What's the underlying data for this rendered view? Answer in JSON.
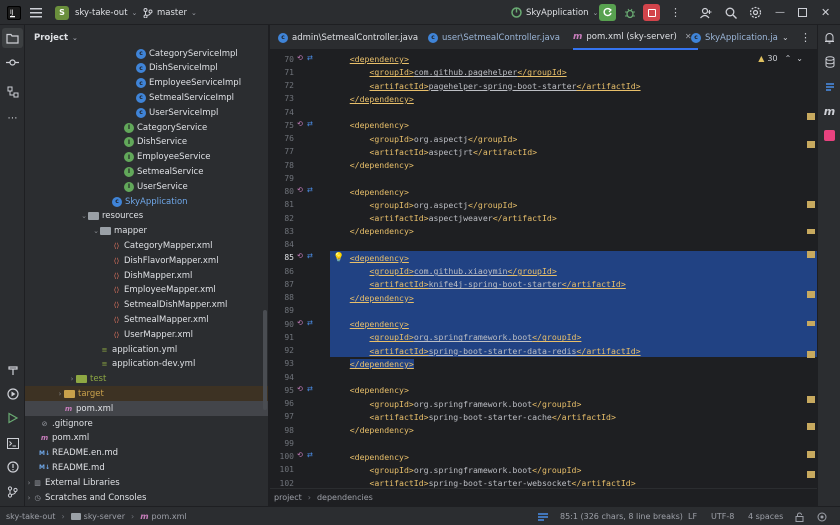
{
  "titlebar": {
    "project_badge": "S",
    "project_name": "sky-take-out",
    "branch": "master",
    "run_config": "SkyApplication"
  },
  "project_panel": {
    "title": "Project",
    "items": [
      {
        "label": "CategoryServiceImpl",
        "icon": "class-blue",
        "indent": 138
      },
      {
        "label": "DishServiceImpl",
        "icon": "class-blue",
        "indent": 138
      },
      {
        "label": "EmployeeServiceImpl",
        "icon": "class-blue",
        "indent": 138
      },
      {
        "label": "SetmealServiceImpl",
        "icon": "class-blue",
        "indent": 138
      },
      {
        "label": "UserServiceImpl",
        "icon": "class-blue",
        "indent": 138
      },
      {
        "label": "CategoryService",
        "icon": "interface-green",
        "indent": 126
      },
      {
        "label": "DishService",
        "icon": "interface-green",
        "indent": 126
      },
      {
        "label": "EmployeeService",
        "icon": "interface-green",
        "indent": 126
      },
      {
        "label": "SetmealService",
        "icon": "interface-green",
        "indent": 126
      },
      {
        "label": "UserService",
        "icon": "interface-green",
        "indent": 126
      },
      {
        "label": "SkyApplication",
        "icon": "class-blue",
        "indent": 114,
        "color": "#6fa7e8"
      },
      {
        "label": "resources",
        "icon": "folder",
        "indent": 90,
        "chevron": "open"
      },
      {
        "label": "mapper",
        "icon": "folder",
        "indent": 102,
        "chevron": "open"
      },
      {
        "label": "CategoryMapper.xml",
        "icon": "xml",
        "indent": 114
      },
      {
        "label": "DishFlavorMapper.xml",
        "icon": "xml",
        "indent": 114
      },
      {
        "label": "DishMapper.xml",
        "icon": "xml",
        "indent": 114
      },
      {
        "label": "EmployeeMapper.xml",
        "icon": "xml",
        "indent": 114
      },
      {
        "label": "SetmealDishMapper.xml",
        "icon": "xml",
        "indent": 114
      },
      {
        "label": "SetmealMapper.xml",
        "icon": "xml",
        "indent": 114
      },
      {
        "label": "UserMapper.xml",
        "icon": "xml",
        "indent": 114
      },
      {
        "label": "application.yml",
        "icon": "yml",
        "indent": 102
      },
      {
        "label": "application-dev.yml",
        "icon": "yml",
        "indent": 102
      },
      {
        "label": "test",
        "icon": "folder",
        "indent": 78,
        "chevron": "closed",
        "color": "#8ea843"
      },
      {
        "label": "target",
        "icon": "folder-orange",
        "indent": 66,
        "chevron": "closed",
        "color": "#c9a14b",
        "bg": "#3d3223"
      },
      {
        "label": "pom.xml",
        "icon": "maven",
        "indent": 66,
        "selected": true
      },
      {
        "label": ".gitignore",
        "icon": "file",
        "indent": 42
      },
      {
        "label": "pom.xml",
        "icon": "maven",
        "indent": 42
      },
      {
        "label": "README.en.md",
        "icon": "md",
        "indent": 42
      },
      {
        "label": "README.md",
        "icon": "md",
        "indent": 42
      },
      {
        "label": "External Libraries",
        "icon": "libs",
        "indent": 18,
        "chevron": "closed"
      },
      {
        "label": "Scratches and Consoles",
        "icon": "scratch",
        "indent": 18,
        "chevron": "closed"
      }
    ]
  },
  "tabs": [
    {
      "label": "admin\\SetmealController.java",
      "icon": "java-icon"
    },
    {
      "label": "user\\SetmealController.java",
      "icon": "java-icon",
      "dim": true
    },
    {
      "label": "pom.xml (sky-server)",
      "icon": "maven-icon",
      "active": true
    },
    {
      "label": "SkyApplication.ja",
      "icon": "java-icon"
    }
  ],
  "editor": {
    "inspection_count": "30",
    "lines": [
      {
        "n": "70",
        "mark": true,
        "indent": 1,
        "parts": [
          [
            "tag",
            "<dependency>"
          ]
        ],
        "underline": true
      },
      {
        "n": "71",
        "indent": 2,
        "parts": [
          [
            "tag",
            "<groupId>"
          ],
          [
            "txt",
            "com.github.pagehelper"
          ],
          [
            "tag",
            "</groupId>"
          ]
        ],
        "underline": true
      },
      {
        "n": "72",
        "indent": 2,
        "parts": [
          [
            "tag",
            "<artifactId>"
          ],
          [
            "txt",
            "pagehelper-spring-boot-starter"
          ],
          [
            "tag",
            "</artifactId>"
          ]
        ],
        "underline": true
      },
      {
        "n": "73",
        "indent": 1,
        "parts": [
          [
            "tag",
            "</dependency>"
          ]
        ],
        "underline": true
      },
      {
        "n": "74",
        "indent": 0,
        "parts": []
      },
      {
        "n": "75",
        "mark": true,
        "indent": 1,
        "parts": [
          [
            "tag",
            "<dependency>"
          ]
        ]
      },
      {
        "n": "76",
        "indent": 2,
        "parts": [
          [
            "tag",
            "<groupId>"
          ],
          [
            "txt",
            "org.aspectj"
          ],
          [
            "tag",
            "</groupId>"
          ]
        ]
      },
      {
        "n": "77",
        "indent": 2,
        "parts": [
          [
            "tag",
            "<artifactId>"
          ],
          [
            "txt",
            "aspectjrt"
          ],
          [
            "tag",
            "</artifactId>"
          ]
        ]
      },
      {
        "n": "78",
        "indent": 1,
        "parts": [
          [
            "tag",
            "</dependency>"
          ]
        ]
      },
      {
        "n": "79",
        "indent": 0,
        "parts": []
      },
      {
        "n": "80",
        "mark": true,
        "indent": 1,
        "parts": [
          [
            "tag",
            "<dependency>"
          ]
        ]
      },
      {
        "n": "81",
        "indent": 2,
        "parts": [
          [
            "tag",
            "<groupId>"
          ],
          [
            "txt",
            "org.aspectj"
          ],
          [
            "tag",
            "</groupId>"
          ]
        ]
      },
      {
        "n": "82",
        "indent": 2,
        "parts": [
          [
            "tag",
            "<artifactId>"
          ],
          [
            "txt",
            "aspectjweaver"
          ],
          [
            "tag",
            "</artifactId>"
          ]
        ]
      },
      {
        "n": "83",
        "indent": 1,
        "parts": [
          [
            "tag",
            "</dependency>"
          ]
        ]
      },
      {
        "n": "84",
        "indent": 0,
        "parts": []
      },
      {
        "n": "85",
        "mark": true,
        "bulb": true,
        "sel": true,
        "indent": 1,
        "parts": [
          [
            "tag",
            "<dependency>"
          ]
        ],
        "underline": true
      },
      {
        "n": "86",
        "sel": true,
        "indent": 2,
        "parts": [
          [
            "tag",
            "<groupId>"
          ],
          [
            "txt",
            "com.github.xiaoymin"
          ],
          [
            "tag",
            "</groupId>"
          ]
        ],
        "underline": true
      },
      {
        "n": "87",
        "sel": true,
        "indent": 2,
        "parts": [
          [
            "tag",
            "<artifactId>"
          ],
          [
            "txt",
            "knife4j-spring-boot-starter"
          ],
          [
            "tag",
            "</artifactId>"
          ]
        ],
        "underline": true
      },
      {
        "n": "88",
        "sel": true,
        "indent": 1,
        "parts": [
          [
            "tag",
            "</dependency>"
          ]
        ],
        "underline": true
      },
      {
        "n": "89",
        "sel": true,
        "indent": 0,
        "parts": []
      },
      {
        "n": "90",
        "mark": true,
        "sel": true,
        "indent": 1,
        "parts": [
          [
            "tag",
            "<dependency>"
          ]
        ],
        "underline": true
      },
      {
        "n": "91",
        "sel": true,
        "indent": 2,
        "parts": [
          [
            "tag",
            "<groupId>"
          ],
          [
            "txt",
            "org.springframework.boot"
          ],
          [
            "tag",
            "</groupId>"
          ]
        ],
        "underline": true
      },
      {
        "n": "92",
        "sel": true,
        "indent": 2,
        "parts": [
          [
            "tag",
            "<artifactId>"
          ],
          [
            "txt",
            "spring-boot-starter-data-redis"
          ],
          [
            "tag",
            "</artifactId>"
          ]
        ],
        "underline": true
      },
      {
        "n": "93",
        "sel": true,
        "selPartial": true,
        "indent": 1,
        "parts": [
          [
            "tag",
            "</dependency>"
          ]
        ],
        "underline": true
      },
      {
        "n": "94",
        "indent": 0,
        "parts": []
      },
      {
        "n": "95",
        "mark": true,
        "indent": 1,
        "parts": [
          [
            "tag",
            "<dependency>"
          ]
        ]
      },
      {
        "n": "96",
        "indent": 2,
        "parts": [
          [
            "tag",
            "<groupId>"
          ],
          [
            "txt",
            "org.springframework.boot"
          ],
          [
            "tag",
            "</groupId>"
          ]
        ]
      },
      {
        "n": "97",
        "indent": 2,
        "parts": [
          [
            "tag",
            "<artifactId>"
          ],
          [
            "txt",
            "spring-boot-starter-cache"
          ],
          [
            "tag",
            "</artifactId>"
          ]
        ]
      },
      {
        "n": "98",
        "indent": 1,
        "parts": [
          [
            "tag",
            "</dependency>"
          ]
        ]
      },
      {
        "n": "99",
        "indent": 0,
        "parts": []
      },
      {
        "n": "100",
        "mark": true,
        "indent": 1,
        "parts": [
          [
            "tag",
            "<dependency>"
          ]
        ]
      },
      {
        "n": "101",
        "indent": 2,
        "parts": [
          [
            "tag",
            "<groupId>"
          ],
          [
            "txt",
            "org.springframework.boot"
          ],
          [
            "tag",
            "</groupId>"
          ]
        ]
      },
      {
        "n": "102",
        "indent": 2,
        "parts": [
          [
            "tag",
            "<artifactId>"
          ],
          [
            "txt",
            "spring-boot-starter-websocket"
          ],
          [
            "tag",
            "</artifactId>"
          ]
        ]
      }
    ]
  },
  "breadcrumbs": [
    "project",
    "dependencies"
  ],
  "statusbar": {
    "path": [
      "sky-take-out",
      "sky-server",
      "pom.xml"
    ],
    "position": "85:1 (326 chars, 8 line breaks)",
    "line_ending": "LF",
    "encoding": "UTF-8",
    "indent": "4 spaces"
  },
  "colors": {
    "accent": "#3574f0",
    "selection": "#214283",
    "tag": "#e8bf6a",
    "text": "#bcbec4"
  }
}
